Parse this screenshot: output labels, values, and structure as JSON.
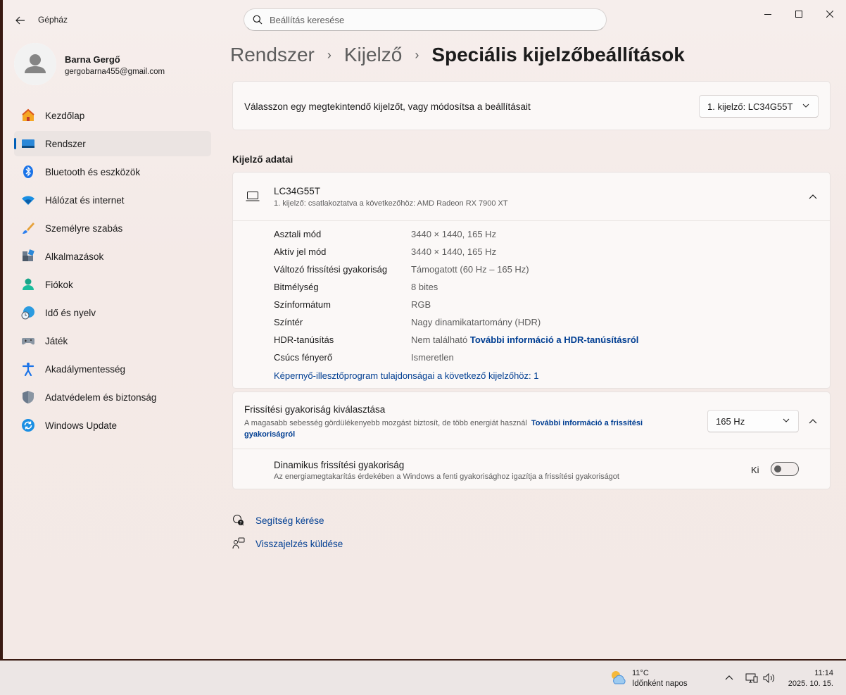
{
  "app": {
    "title": "Gépház",
    "search_placeholder": "Beállítás keresése"
  },
  "user": {
    "name": "Barna Gergő",
    "email": "gergobarna455@gmail.com"
  },
  "sidebar": {
    "items": [
      {
        "label": "Kezdőlap",
        "icon": "home-icon"
      },
      {
        "label": "Rendszer",
        "icon": "system-icon",
        "active": true
      },
      {
        "label": "Bluetooth és eszközök",
        "icon": "bluetooth-icon"
      },
      {
        "label": "Hálózat és internet",
        "icon": "wifi-icon"
      },
      {
        "label": "Személyre szabás",
        "icon": "brush-icon"
      },
      {
        "label": "Alkalmazások",
        "icon": "apps-icon"
      },
      {
        "label": "Fiókok",
        "icon": "person-icon"
      },
      {
        "label": "Idő és nyelv",
        "icon": "globe-clock-icon"
      },
      {
        "label": "Játék",
        "icon": "gamepad-icon"
      },
      {
        "label": "Akadálymentesség",
        "icon": "accessibility-icon"
      },
      {
        "label": "Adatvédelem és biztonság",
        "icon": "shield-icon"
      },
      {
        "label": "Windows Update",
        "icon": "update-icon"
      }
    ]
  },
  "breadcrumb": {
    "level1": "Rendszer",
    "level2": "Kijelző",
    "current": "Speciális kijelzőbeállítások"
  },
  "display_select": {
    "label": "Válasszon egy megtekintendő kijelzőt, vagy módosítsa a beállításait",
    "value": "1. kijelző: LC34G55T"
  },
  "section_title": "Kijelző adatai",
  "monitor": {
    "name": "LC34G55T",
    "subtitle": "1. kijelző: csatlakoztatva a következőhöz: AMD Radeon RX 7900 XT",
    "details": [
      {
        "label": "Asztali mód",
        "value": "3440 × 1440, 165 Hz"
      },
      {
        "label": "Aktív jel mód",
        "value": "3440 × 1440, 165 Hz"
      },
      {
        "label": "Változó frissítési gyakoriság",
        "value": "Támogatott (60 Hz – 165 Hz)"
      },
      {
        "label": "Bitmélység",
        "value": "8 bites"
      },
      {
        "label": "Színformátum",
        "value": "RGB"
      },
      {
        "label": "Színtér",
        "value": "Nagy dinamikatartomány (HDR)"
      },
      {
        "label": "HDR-tanúsítás",
        "value": "Nem található",
        "link": "További információ a HDR-tanúsításról"
      },
      {
        "label": "Csúcs fényerő",
        "value": "Ismeretlen"
      }
    ],
    "adapter_link": "Képernyő-illesztőprogram tulajdonságai a következő kijelzőhöz: 1"
  },
  "refresh": {
    "title": "Frissítési gyakoriság kiválasztása",
    "desc": "A magasabb sebesség gördülékenyebb mozgást biztosít, de több energiát használ",
    "link": "További információ a frissítési gyakoriságról",
    "value": "165 Hz",
    "dynamic_title": "Dinamikus frissítési gyakoriság",
    "dynamic_desc": "Az energiamegtakarítás érdekében a Windows a fenti gyakorisághoz igazítja a frissítési gyakoriságot",
    "toggle_label": "Ki",
    "toggle_on": false
  },
  "footer": {
    "help": "Segítség kérése",
    "feedback": "Visszajelzés küldése"
  },
  "taskbar": {
    "temp": "11°C",
    "weather": "Időnként napos",
    "time": "11:14",
    "date": "2025. 10. 15."
  },
  "colors": {
    "accent": "#005fb8",
    "link": "#003e92"
  }
}
